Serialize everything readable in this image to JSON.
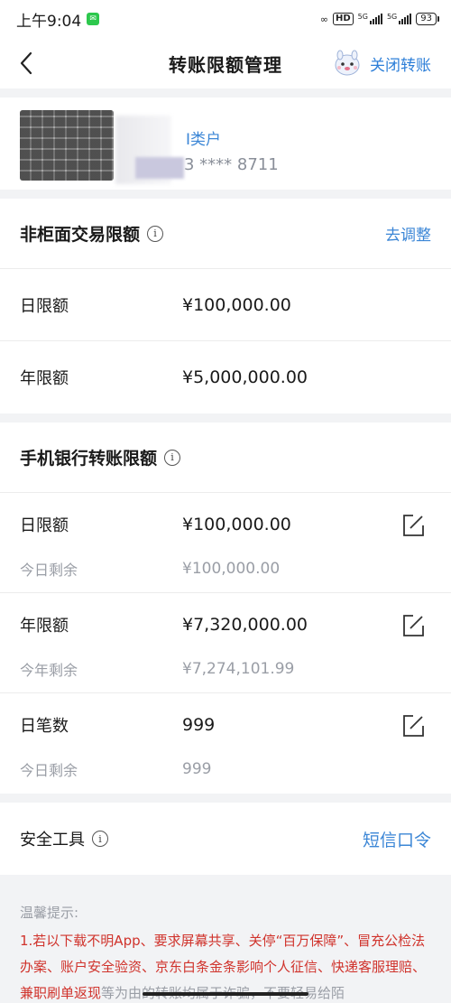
{
  "status_bar": {
    "time": "上午9:04",
    "hd": "HD",
    "net1": "5G",
    "net2": "5G",
    "battery": "93"
  },
  "nav": {
    "title": "转账限额管理",
    "right_action": "关闭转账"
  },
  "account": {
    "type": "I类户",
    "number": "3 **** 8711"
  },
  "non_counter": {
    "title": "非柜面交易限额",
    "action": "去调整",
    "rows": [
      {
        "label": "日限额",
        "value": "¥100,000.00"
      },
      {
        "label": "年限额",
        "value": "¥5,000,000.00"
      }
    ]
  },
  "mobile": {
    "title": "手机银行转账限额",
    "rows": [
      {
        "label": "日限额",
        "value": "¥100,000.00",
        "sub_label": "今日剩余",
        "sub_value": "¥100,000.00"
      },
      {
        "label": "年限额",
        "value": "¥7,320,000.00",
        "sub_label": "今年剩余",
        "sub_value": "¥7,274,101.99"
      },
      {
        "label": "日笔数",
        "value": "999",
        "sub_label": "今日剩余",
        "sub_value": "999"
      }
    ]
  },
  "security": {
    "title": "安全工具",
    "action": "短信口令"
  },
  "tips": {
    "title": "温馨提示:",
    "text_red_1": "1.若以下载不明App、要求屏幕共享、关停“百万保障”、冒充公检法办案、账户安全验资、京东白条金条影响个人征信、快递客服理赔、兼职刷单返现",
    "text_grey": "等为由的转账均属于诈骗，不要轻易给陌"
  },
  "colors": {
    "accent": "#3b86d6",
    "warning": "#d0332c",
    "muted": "#9a9ea6"
  }
}
